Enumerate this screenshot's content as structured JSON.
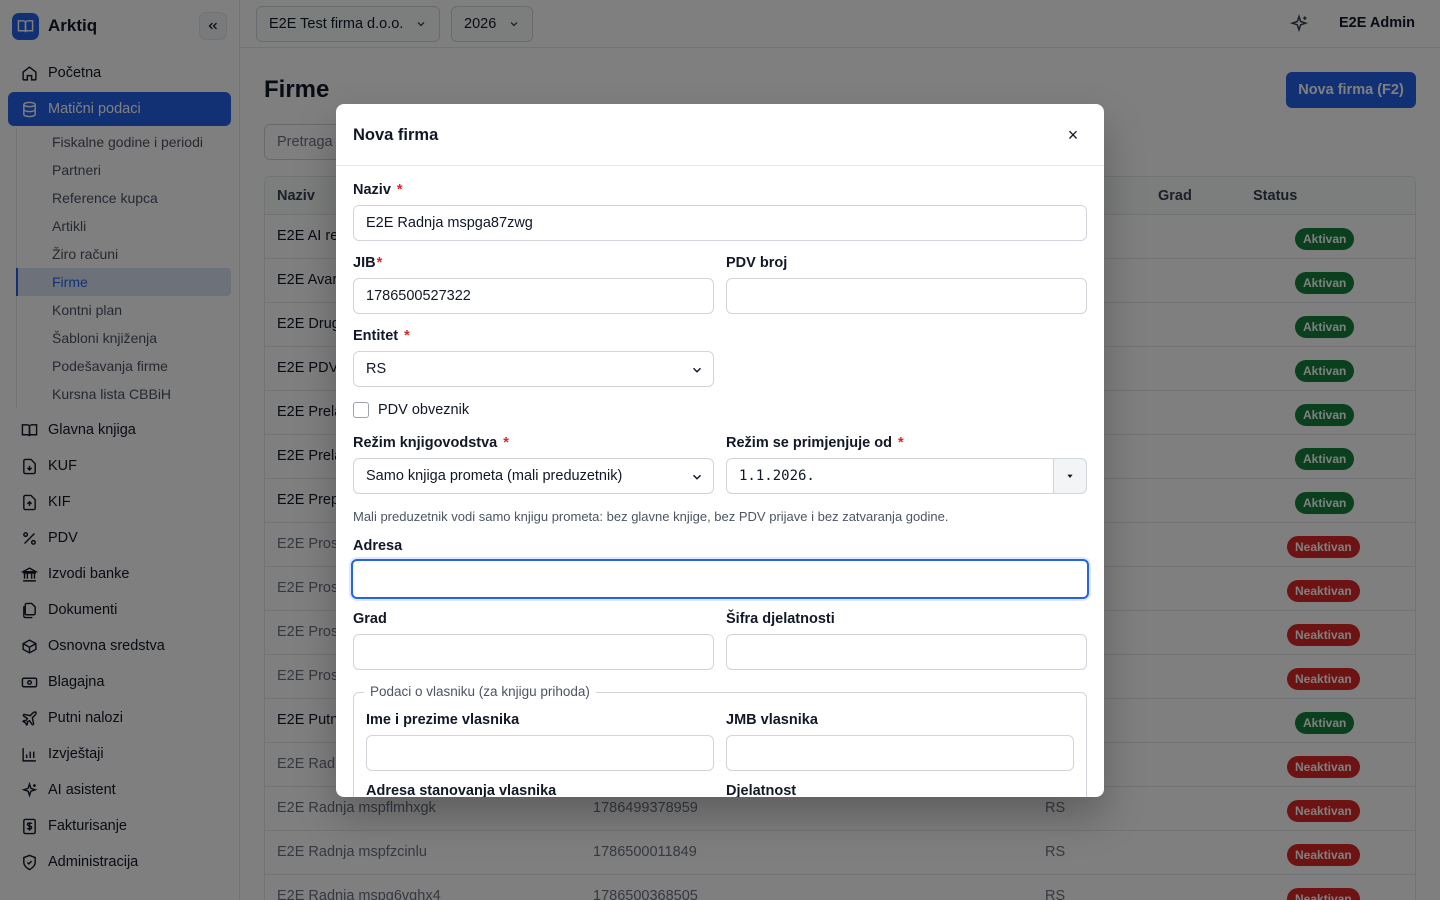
{
  "app": {
    "name": "Arktiq"
  },
  "header": {
    "company": "E2E Test firma d.o.o.",
    "year": "2026",
    "user": "E2E Admin"
  },
  "sidebar": {
    "top_items": [
      {
        "label": "Početna",
        "icon": "home-icon"
      },
      {
        "label": "Matični podaci",
        "icon": "database-icon"
      }
    ],
    "sub_items": [
      "Fiskalne godine i periodi",
      "Partneri",
      "Reference kupca",
      "Artikli",
      "Žiro računi",
      "Firme",
      "Kontni plan",
      "Šabloni knjiženja",
      "Podešavanja firme",
      "Kursna lista CBBiH"
    ],
    "items": [
      {
        "label": "Glavna knjiga",
        "icon": "book-icon"
      },
      {
        "label": "KUF",
        "icon": "file-in-icon"
      },
      {
        "label": "KIF",
        "icon": "file-out-icon"
      },
      {
        "label": "PDV",
        "icon": "percent-icon"
      },
      {
        "label": "Izvodi banke",
        "icon": "bank-icon"
      },
      {
        "label": "Dokumenti",
        "icon": "documents-icon"
      },
      {
        "label": "Osnovna sredstva",
        "icon": "box-icon"
      },
      {
        "label": "Blagajna",
        "icon": "cash-icon"
      },
      {
        "label": "Putni nalozi",
        "icon": "route-icon"
      },
      {
        "label": "Izvještaji",
        "icon": "chart-icon"
      },
      {
        "label": "AI asistent",
        "icon": "sparkle-icon"
      },
      {
        "label": "Fakturisanje",
        "icon": "invoice-icon"
      },
      {
        "label": "Administracija",
        "icon": "shield-icon"
      }
    ]
  },
  "page": {
    "title": "Firme",
    "new_button": "Nova firma (F2)",
    "search_placeholder": "Pretraga",
    "columns": {
      "naziv": "Naziv",
      "grad": "Grad",
      "status": "Status"
    },
    "rows": [
      {
        "naziv": "E2E AI re",
        "jib": "",
        "entitet": "",
        "status": "Aktivan",
        "active": true
      },
      {
        "naziv": "E2E Avar",
        "jib": "",
        "entitet": "",
        "status": "Aktivan",
        "active": true
      },
      {
        "naziv": "E2E Drug",
        "jib": "",
        "entitet": "",
        "status": "Aktivan",
        "active": true
      },
      {
        "naziv": "E2E PDV",
        "jib": "",
        "entitet": "",
        "status": "Aktivan",
        "active": true
      },
      {
        "naziv": "E2E Prela",
        "jib": "",
        "entitet": "",
        "status": "Aktivan",
        "active": true
      },
      {
        "naziv": "E2E Prela",
        "jib": "",
        "entitet": "",
        "status": "Aktivan",
        "active": true
      },
      {
        "naziv": "E2E Prep",
        "jib": "",
        "entitet": "",
        "status": "Aktivan",
        "active": true
      },
      {
        "naziv": "E2E Pros",
        "jib": "",
        "entitet": "",
        "status": "Neaktivan",
        "active": false
      },
      {
        "naziv": "E2E Pros",
        "jib": "",
        "entitet": "",
        "status": "Neaktivan",
        "active": false
      },
      {
        "naziv": "E2E Pros",
        "jib": "",
        "entitet": "",
        "status": "Neaktivan",
        "active": false
      },
      {
        "naziv": "E2E Pros",
        "jib": "",
        "entitet": "",
        "status": "Neaktivan",
        "active": false
      },
      {
        "naziv": "E2E Putn",
        "jib": "",
        "entitet": "",
        "status": "Aktivan",
        "active": true
      },
      {
        "naziv": "E2E Radr",
        "jib": "",
        "entitet": "",
        "status": "Neaktivan",
        "active": false
      },
      {
        "naziv": "E2E Radnja mspflmhxgk",
        "jib": "1786499378959",
        "entitet": "RS",
        "status": "Neaktivan",
        "active": false
      },
      {
        "naziv": "E2E Radnja mspfzcinlu",
        "jib": "1786500011849",
        "entitet": "RS",
        "status": "Neaktivan",
        "active": false
      },
      {
        "naziv": "E2E Radnja mspg6vghx4",
        "jib": "1786500368505",
        "entitet": "RS",
        "status": "Neaktivan",
        "active": false
      }
    ]
  },
  "modal": {
    "title": "Nova firma",
    "naziv_label": "Naziv",
    "naziv_value": "E2E Radnja mspga87zwg",
    "jib_label": "JIB",
    "jib_value": "1786500527322",
    "pdv_broj_label": "PDV broj",
    "pdv_broj_value": "",
    "entitet_label": "Entitet",
    "entitet_value": "RS",
    "pdv_obveznik_label": "PDV obveznik",
    "rezim_label": "Režim knjigovodstva",
    "rezim_value": "Samo knjiga prometa (mali preduzetnik)",
    "rezim_od_label": "Režim se primjenjuje od",
    "rezim_od_value": "1.1.2026.",
    "hint": "Mali preduzetnik vodi samo knjigu prometa: bez glavne knjige, bez PDV prijave i bez zatvaranja godine.",
    "adresa_label": "Adresa",
    "grad_label": "Grad",
    "sifra_label": "Šifra djelatnosti",
    "owner_legend": "Podaci o vlasniku (za knjigu prihoda)",
    "owner_name_label": "Ime i prezime vlasnika",
    "owner_jmb_label": "JMB vlasnika",
    "owner_address_label": "Adresa stanovanja vlasnika",
    "djelatnost_label": "Djelatnost"
  },
  "colors": {
    "accent": "#2563eb",
    "active_badge": "#15803d",
    "inactive_badge": "#dc2626"
  }
}
